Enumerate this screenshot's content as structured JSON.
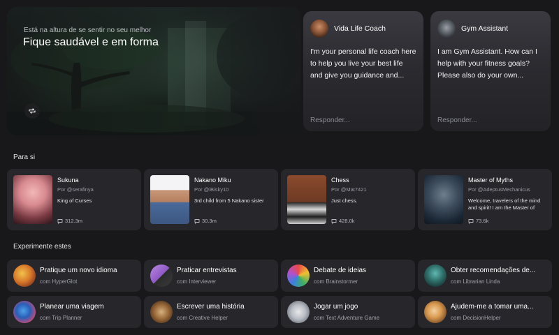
{
  "hero": {
    "eyebrow": "Está na altura de se sentir no seu melhor",
    "title": "Fique saudável e em forma",
    "switch_icon": "refresh-icon"
  },
  "chats": [
    {
      "name": "Vida Life Coach",
      "message": "I'm your personal life coach here to help you live your best life and give you guidance and...",
      "reply_placeholder": "Responder..."
    },
    {
      "name": "Gym Assistant",
      "message": "I am Gym Assistant. How can I help with your fitness goals? Please also do your own...",
      "reply_placeholder": "Responder..."
    }
  ],
  "for_you": {
    "title": "Para si",
    "cards": [
      {
        "name": "Sukuna",
        "by": "Por @serafinya",
        "desc": "King of Curses",
        "count": "312.3m"
      },
      {
        "name": "Nakano Miku",
        "by": "Por @iBisky10",
        "desc": "3rd child from 5 Nakano sister",
        "count": "30.3m"
      },
      {
        "name": "Chess",
        "by": "Por @Mat7421",
        "desc": "Just chess.",
        "count": "428.0k"
      },
      {
        "name": "Master of Myths",
        "by": "Por @AdeptusMechanicus",
        "desc": "Welcome, travelers of the mind and spirit! I am the Master of Myths, Here, stories breathe...",
        "count": "73.6k"
      }
    ]
  },
  "try_these": {
    "title": "Experimente estes",
    "cards": [
      {
        "title": "Pratique um novo idioma",
        "sub": "com HyperGlot"
      },
      {
        "title": "Praticar entrevistas",
        "sub": "com Interviewer"
      },
      {
        "title": "Debate de ideias",
        "sub": "com Brainstormer"
      },
      {
        "title": "Obter recomendações de...",
        "sub": "com Librarian Linda"
      },
      {
        "title": "Planear uma viagem",
        "sub": "com Trip Planner"
      },
      {
        "title": "Escrever uma história",
        "sub": "com Creative Helper"
      },
      {
        "title": "Jogar um jogo",
        "sub": "com Text Adventure Game"
      },
      {
        "title": "Ajudem-me a tomar uma...",
        "sub": "com DecisionHelper"
      }
    ]
  },
  "colors": {
    "background": "#18181b",
    "card": "#26262b"
  }
}
